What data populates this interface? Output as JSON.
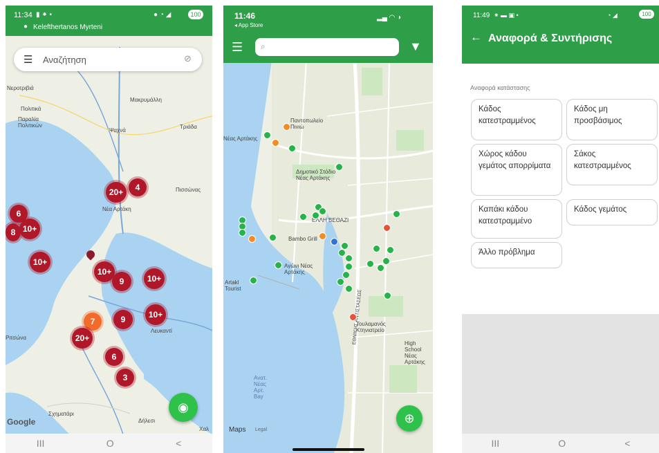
{
  "phone1": {
    "time": "11:34",
    "battery": "100",
    "user": "Kelefthertanos Myrteni",
    "search_placeholder": "Αναζήτηση",
    "map_labels": [
      "Νεροτριβιά",
      "Πολιτικά",
      "Παραλία Πολιτικών",
      "Μακρυμάλλη",
      "Ψαχνά",
      "Τριάδα",
      "Νέα Αρτάκη",
      "Πισσώνας",
      "Ριτσώνα",
      "Λευκαντί",
      "Σχηματάρι",
      "Δήλεσι",
      "Χαλ"
    ],
    "clusters": [
      "20+",
      "4",
      "6",
      "10+",
      "8",
      "10+",
      "10+",
      "9",
      "10+",
      "9",
      "10+",
      "7",
      "20+",
      "6",
      "3"
    ],
    "google_label": "Google",
    "nav": [
      "III",
      "O",
      "<"
    ]
  },
  "phone2": {
    "time": "11:46",
    "back_label": "◂ App Store",
    "map_labels": [
      "Παντοπωλείο Πινιώ",
      "Δημοτικό Στάδιο Νέας Αρτάκης",
      "ΕΛΛΗ ΒΕΘΑΖΙ",
      "Bambo Grill",
      "Αγώνι Νέας Αρτάκης",
      "Artakl Tourist",
      "Νέας Αρτάκης",
      "Τουλαμανός Κτηνιατρείο",
      "High School Νέας Αρτάκης",
      "Ανατ. Νέας Αρτ. Bay"
    ],
    "street": "ΕΘΝΙΚΗΣ ΑΝΤΙΣΤΑΣΕΩΣ",
    "maps_label": "Maps",
    "legal_label": "Legal"
  },
  "phone3": {
    "time": "11:49",
    "battery": "100",
    "title": "Αναφορά & Συντήρισης",
    "section_label": "Αναφορά κατάστασης",
    "options": [
      "Κάδος κατεστραμμένος",
      "Κάδος μη προσβάσιμος",
      "Χώρος κάδου γεμάτος απορρίματα",
      "Σάκος κατεστραμμένος",
      "Καπάκι κάδου κατεστραμμένο",
      "Κάδος γεμάτος",
      "Άλλο πρόβλημα"
    ],
    "nav": [
      "III",
      "O",
      "<"
    ]
  },
  "colors": {
    "green": "#2e9e49",
    "cluster": "#b0182a",
    "water": "#aad3f2",
    "land": "#eef0e6"
  }
}
